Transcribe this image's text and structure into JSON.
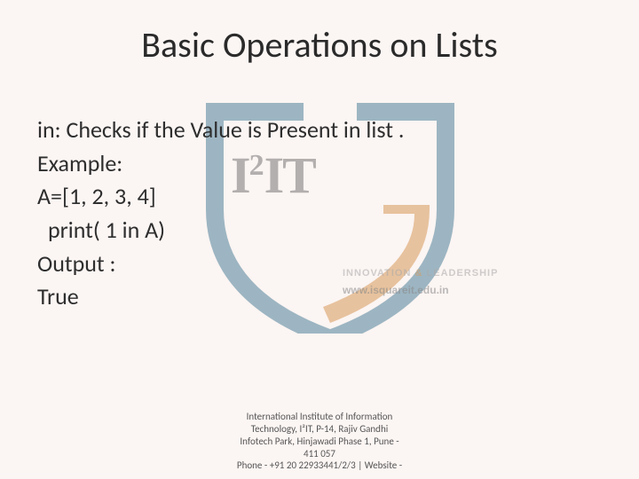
{
  "title": "Basic Operations on Lists",
  "content": {
    "line1": "in: Checks if the Value is Present in list .",
    "line2": "Example:",
    "line3": "A=[1, 2, 3, 4]",
    "line4": "print( 1 in A)",
    "line5": "Output :",
    "line6": "True"
  },
  "logo": {
    "mark_text": "I²IT",
    "tagline_a": "INNOVATION",
    "tagline_amp": "&",
    "tagline_b": "LEADERSHIP",
    "website": "www.isquareit.edu.in",
    "shield_color": "#51829b",
    "accent_color": "#d89a5a"
  },
  "footer": {
    "line1": "International Institute of Information",
    "line2": "Technology, I²IT, P-14, Rajiv Gandhi",
    "line3": "Infotech Park, Hinjawadi Phase 1, Pune -",
    "line4": "411 057",
    "line5": "Phone - +91 20 22933441/2/3 | Website -"
  }
}
